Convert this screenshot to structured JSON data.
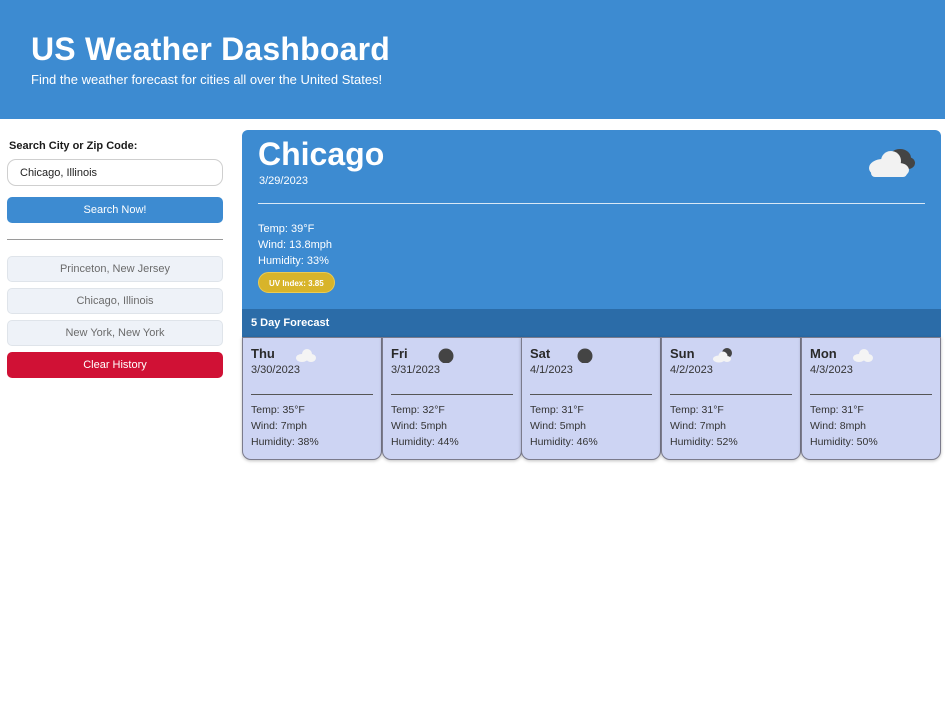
{
  "header": {
    "title": "US Weather Dashboard",
    "subtitle": "Find the weather forecast for cities all over the United States!"
  },
  "search": {
    "label": "Search City or Zip Code:",
    "value": "Chicago, Illinois",
    "button_label": "Search Now!"
  },
  "history": {
    "items": [
      "Princeton, New Jersey",
      "Chicago, Illinois",
      "New York, New York"
    ],
    "clear_label": "Clear History"
  },
  "current": {
    "city": "Chicago",
    "date": "3/29/2023",
    "icon": "cloudy-icon",
    "temp": "Temp: 39°F",
    "wind": "Wind: 13.8mph",
    "humidity": "Humidity: 33%",
    "uv": "UV Index: 3.85"
  },
  "forecast": {
    "title": "5 Day Forecast",
    "days": [
      {
        "day": "Thu",
        "date": "3/30/2023",
        "icon": "cloud-icon",
        "temp": "Temp: 35°F",
        "wind": "Wind: 7mph",
        "humidity": "Humidity: 38%"
      },
      {
        "day": "Fri",
        "date": "3/31/2023",
        "icon": "moon-icon",
        "temp": "Temp: 32°F",
        "wind": "Wind: 5mph",
        "humidity": "Humidity: 44%"
      },
      {
        "day": "Sat",
        "date": "4/1/2023",
        "icon": "moon-icon",
        "temp": "Temp: 31°F",
        "wind": "Wind: 5mph",
        "humidity": "Humidity: 46%"
      },
      {
        "day": "Sun",
        "date": "4/2/2023",
        "icon": "partly-cloudy-night-icon",
        "temp": "Temp: 31°F",
        "wind": "Wind: 7mph",
        "humidity": "Humidity: 52%"
      },
      {
        "day": "Mon",
        "date": "4/3/2023",
        "icon": "cloud-icon",
        "temp": "Temp: 31°F",
        "wind": "Wind: 8mph",
        "humidity": "Humidity: 50%"
      }
    ]
  },
  "colors": {
    "primary": "#3d8bd1",
    "forecast_bar": "#2b6ca8",
    "card": "#cdd4f3",
    "danger": "#d01135",
    "uv_badge": "#d8b42a"
  }
}
